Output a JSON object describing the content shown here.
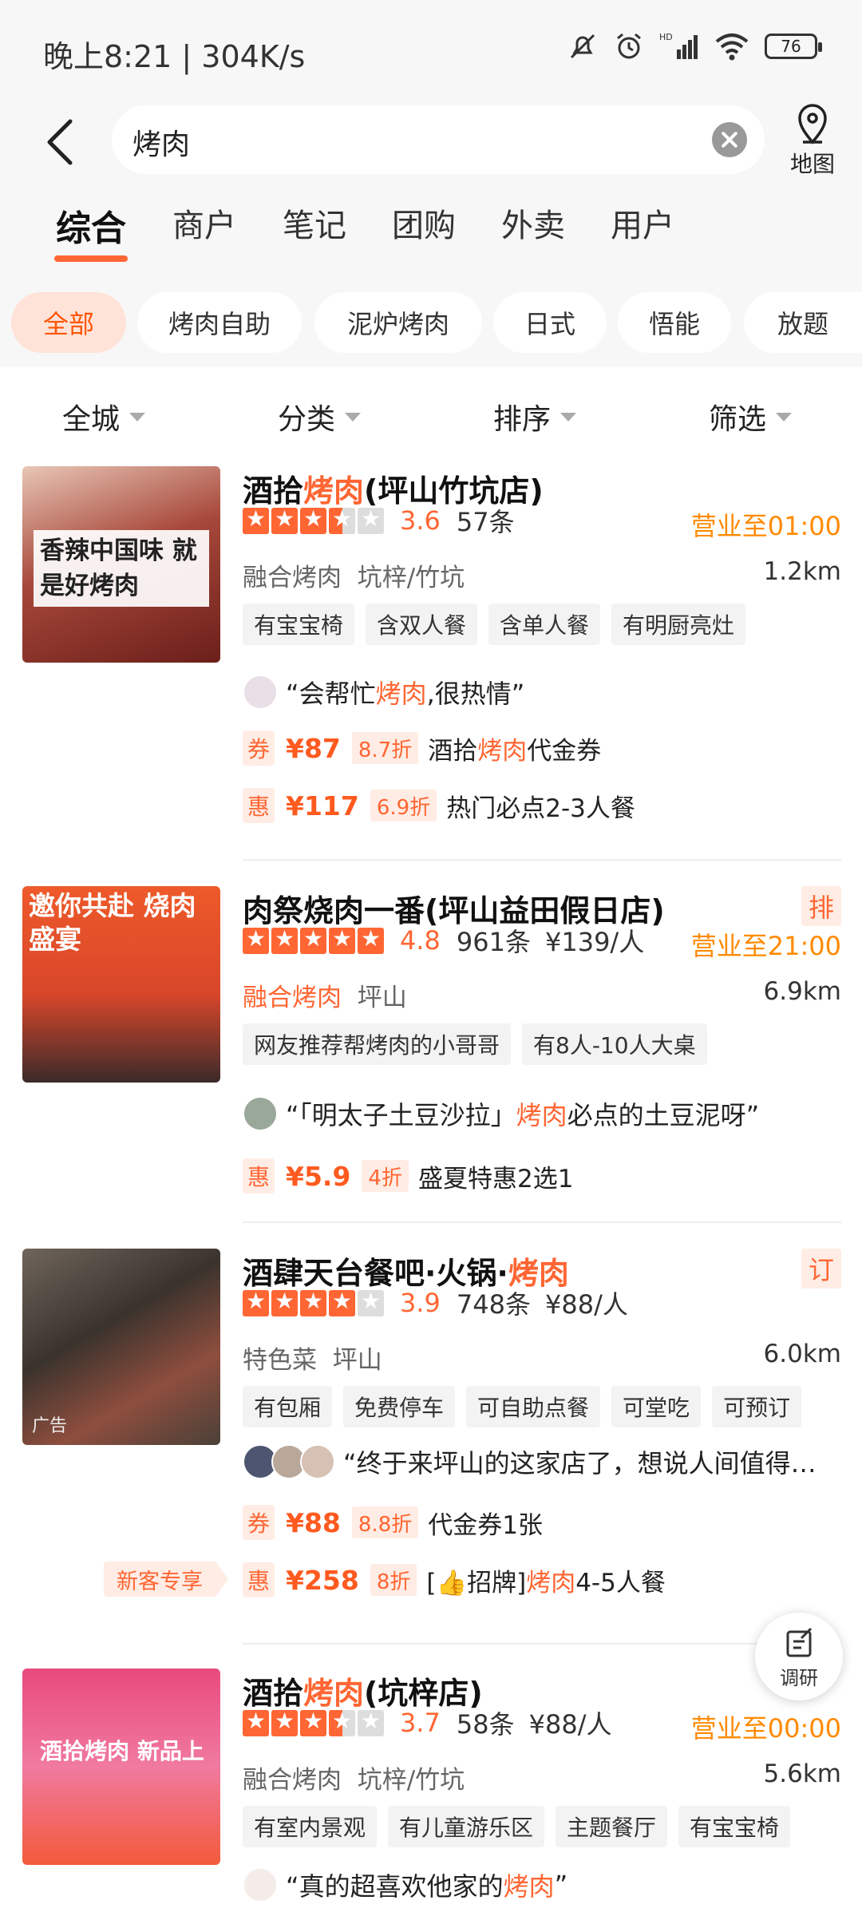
{
  "status_bar": {
    "time": "晚上8:21 | 304K/s",
    "battery": "76"
  },
  "search": {
    "query": "烤肉",
    "map_label": "地图"
  },
  "tabs": [
    "综合",
    "商户",
    "笔记",
    "团购",
    "外卖",
    "用户"
  ],
  "chips": [
    "全部",
    "烤肉自助",
    "泥炉烤肉",
    "日式",
    "悟能",
    "放题"
  ],
  "filters": [
    "全城",
    "分类",
    "排序",
    "筛选"
  ],
  "float_button": {
    "label": "调研"
  },
  "colors": {
    "accent": "#ff6633",
    "open": "#ff8a00",
    "background": "#f7f7f7"
  },
  "listings": [
    {
      "title_pre": "酒拾",
      "title_hl": "烤肉",
      "title_post": "(坪山竹坑店)",
      "thumb_text": "香辣中国味 就是好烤肉",
      "rating": 3.6,
      "score": "3.6",
      "reviews": "57条",
      "price": "",
      "open": "营业至01:00",
      "category": "融合烤肉",
      "area": "坑梓/竹坑",
      "distance": "1.2km",
      "tags": [
        "有宝宝椅",
        "含双人餐",
        "含单人餐",
        "有明厨亮灶"
      ],
      "review_pre": "“会帮忙",
      "review_hl": "烤肉",
      "review_post": ",很热情”",
      "deals": [
        {
          "icon": "券",
          "price": "¥87",
          "discount": "8.7折",
          "pre": "酒拾",
          "hl": "烤肉",
          "post": "代金券"
        },
        {
          "icon": "惠",
          "price": "¥117",
          "discount": "6.9折",
          "pre": "热门必点2-3人餐",
          "hl": "",
          "post": ""
        }
      ]
    },
    {
      "title_pre": "肉祭烧肉一番(坪山益田假日店)",
      "title_hl": "",
      "title_post": "",
      "badge": "排",
      "thumb_text": "邀你共赴 烧肉盛宴",
      "rating": 4.8,
      "score": "4.8",
      "reviews": "961条",
      "price": "¥139/人",
      "open": "营业至21:00",
      "category": "融合烤肉",
      "area": "坪山",
      "distance": "6.9km",
      "tags": [
        "网友推荐帮烤肉的小哥哥",
        "有8人-10人大桌"
      ],
      "review_pre": "“「明太子土豆沙拉」",
      "review_hl": "烤肉",
      "review_post": "必点的土豆泥呀”",
      "deals": [
        {
          "icon": "惠",
          "price": "¥5.9",
          "discount": "4折",
          "pre": "盛夏特惠2选1",
          "hl": "",
          "post": ""
        }
      ]
    },
    {
      "title_pre": "酒肆天台餐吧·火锅·",
      "title_hl": "烤肉",
      "title_post": "",
      "badge": "订",
      "ad_label": "广告",
      "rating": 3.9,
      "score": "3.9",
      "reviews": "748条",
      "price": "¥88/人",
      "open": "",
      "category": "特色菜",
      "area": "坪山",
      "distance": "6.0km",
      "tags": [
        "有包厢",
        "免费停车",
        "可自助点餐",
        "可堂吃",
        "可预订"
      ],
      "review_pre": "“终于来坪山的这家店了，想说人间值得…",
      "review_hl": "",
      "review_post": "",
      "deals": [
        {
          "icon": "券",
          "price": "¥88",
          "discount": "8.8折",
          "pre": "代金券1张",
          "hl": "",
          "post": ""
        },
        {
          "icon": "惠",
          "price": "¥258",
          "discount": "8折",
          "pre": "[👍招牌]",
          "hl": "烤肉",
          "post": "4-5人餐",
          "tag": "新客专享"
        }
      ]
    },
    {
      "title_pre": "酒拾",
      "title_hl": "烤肉",
      "title_post": "(坑梓店)",
      "thumb_text": "酒拾烤肉 新品上市",
      "rating": 3.7,
      "score": "3.7",
      "reviews": "58条",
      "price": "¥88/人",
      "open": "营业至00:00",
      "category": "融合烤肉",
      "area": "坑梓/竹坑",
      "distance": "5.6km",
      "tags": [
        "有室内景观",
        "有儿童游乐区",
        "主题餐厅",
        "有宝宝椅"
      ],
      "review_pre": "“真的超喜欢他家的",
      "review_hl": "烤肉",
      "review_post": "”",
      "deals": []
    }
  ]
}
